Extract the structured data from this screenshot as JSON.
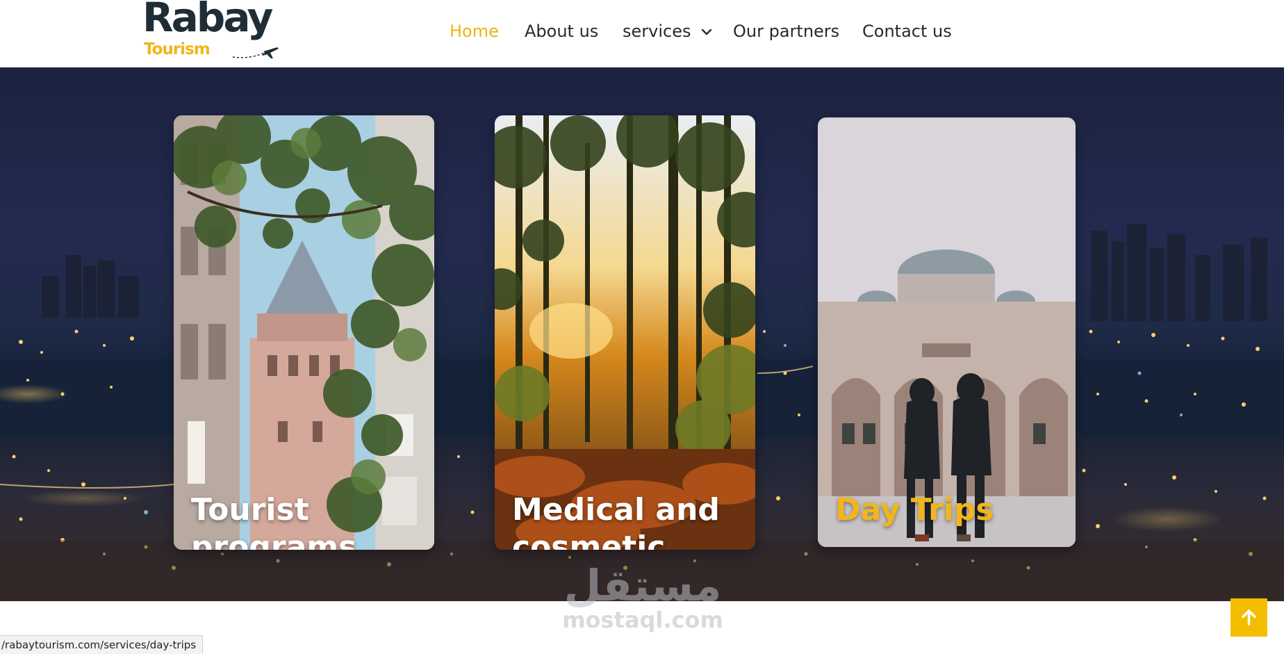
{
  "header": {
    "logo": {
      "main": "Rabay",
      "sub": "Tourism"
    },
    "nav": [
      {
        "label": "Home",
        "active": true
      },
      {
        "label": "About us",
        "active": false
      },
      {
        "label": "services",
        "active": false,
        "icon": "chevron-down-icon"
      },
      {
        "label": "Our partners",
        "active": false
      },
      {
        "label": "Contact us",
        "active": false
      }
    ]
  },
  "hero": {
    "background": "night-city-skyline",
    "cards": [
      {
        "title": "Tourist programs",
        "image": "galata-tower-with-tree-branches"
      },
      {
        "title": "Medical and cosmetic Tourism",
        "image": "forest-sunset"
      },
      {
        "title": "Day Trips",
        "image": "mosque-couple-walking",
        "title_color": "#f2b61b"
      }
    ]
  },
  "watermark": {
    "arabic": "مستقل",
    "latin": "mostaql.com"
  },
  "status_bar": {
    "url": "/rabaytourism.com/services/day-trips"
  },
  "back_to_top": {
    "icon": "arrow-up-icon",
    "color": "#f5bd00"
  },
  "colors": {
    "accent": "#eeb419",
    "nav_text": "#222b33",
    "hero_bg": "#1f2746"
  }
}
